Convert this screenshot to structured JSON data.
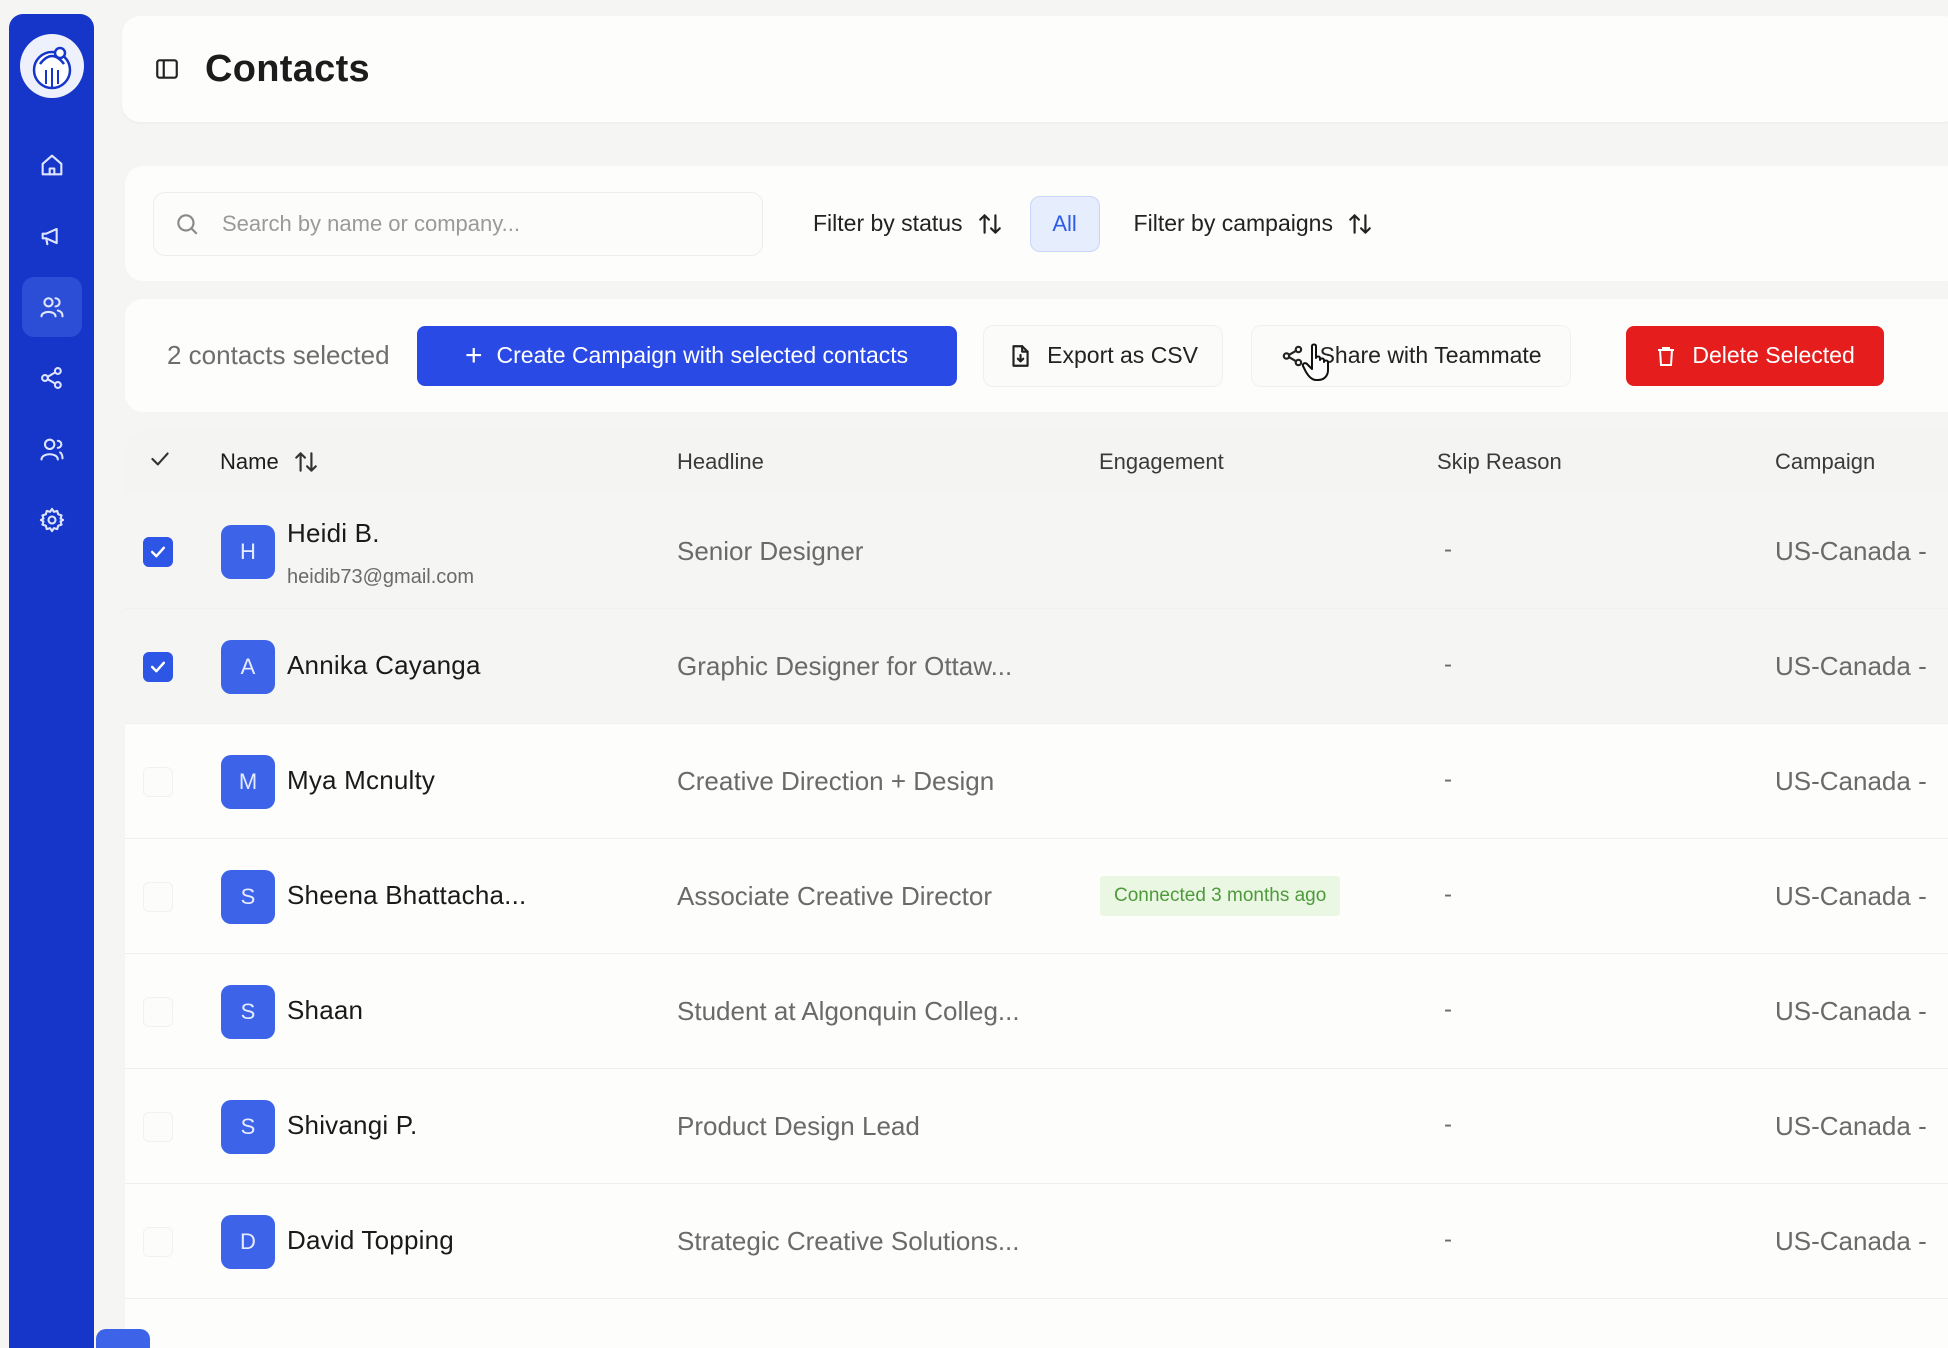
{
  "page": {
    "title": "Contacts"
  },
  "sidebar": {
    "items": [
      {
        "icon": "home-icon"
      },
      {
        "icon": "megaphone-icon"
      },
      {
        "icon": "contacts-icon",
        "active": true
      },
      {
        "icon": "share-network-icon"
      },
      {
        "icon": "team-icon"
      },
      {
        "icon": "gear-icon"
      }
    ]
  },
  "search": {
    "placeholder": "Search by name or company..."
  },
  "filters": {
    "status_label": "Filter by status",
    "all_chip": "All",
    "campaigns_label": "Filter by campaigns"
  },
  "actions": {
    "selected_count": "2 contacts selected",
    "create_campaign": "Create Campaign with selected contacts",
    "export_csv": "Export as CSV",
    "share": "Share with Teammate",
    "delete": "Delete Selected"
  },
  "table": {
    "columns": {
      "name": "Name",
      "headline": "Headline",
      "engagement": "Engagement",
      "skip_reason": "Skip Reason",
      "campaign": "Campaign"
    },
    "rows": [
      {
        "initial": "H",
        "name": "Heidi B.",
        "email": "heidib73@gmail.com",
        "headline": "Senior Designer",
        "engagement": "",
        "skip": "-",
        "campaign": "US-Canada -",
        "checked": true
      },
      {
        "initial": "A",
        "name": "Annika Cayanga",
        "email": "",
        "headline": "Graphic Designer for Ottaw...",
        "engagement": "",
        "skip": "-",
        "campaign": "US-Canada -",
        "checked": true
      },
      {
        "initial": "M",
        "name": "Mya Mcnulty",
        "email": "",
        "headline": "Creative Direction + Design",
        "engagement": "",
        "skip": "-",
        "campaign": "US-Canada -",
        "checked": false
      },
      {
        "initial": "S",
        "name": "Sheena Bhattacha...",
        "email": "",
        "headline": "Associate Creative Director",
        "engagement": "Connected 3 months ago",
        "skip": "-",
        "campaign": "US-Canada -",
        "checked": false
      },
      {
        "initial": "S",
        "name": "Shaan",
        "email": "",
        "headline": "Student at Algonquin Colleg...",
        "engagement": "",
        "skip": "-",
        "campaign": "US-Canada -",
        "checked": false
      },
      {
        "initial": "S",
        "name": "Shivangi P.",
        "email": "",
        "headline": "Product Design Lead",
        "engagement": "",
        "skip": "-",
        "campaign": "US-Canada -",
        "checked": false
      },
      {
        "initial": "D",
        "name": "David Topping",
        "email": "",
        "headline": "Strategic Creative Solutions...",
        "engagement": "",
        "skip": "-",
        "campaign": "US-Canada -",
        "checked": false
      }
    ]
  },
  "colors": {
    "sidebar": "#1636c9",
    "primary": "#2a4ae6",
    "danger": "#e51d1d",
    "avatar": "#3d63e8",
    "engagement_bg": "#eaf7e3",
    "engagement_text": "#4e9a3b"
  }
}
